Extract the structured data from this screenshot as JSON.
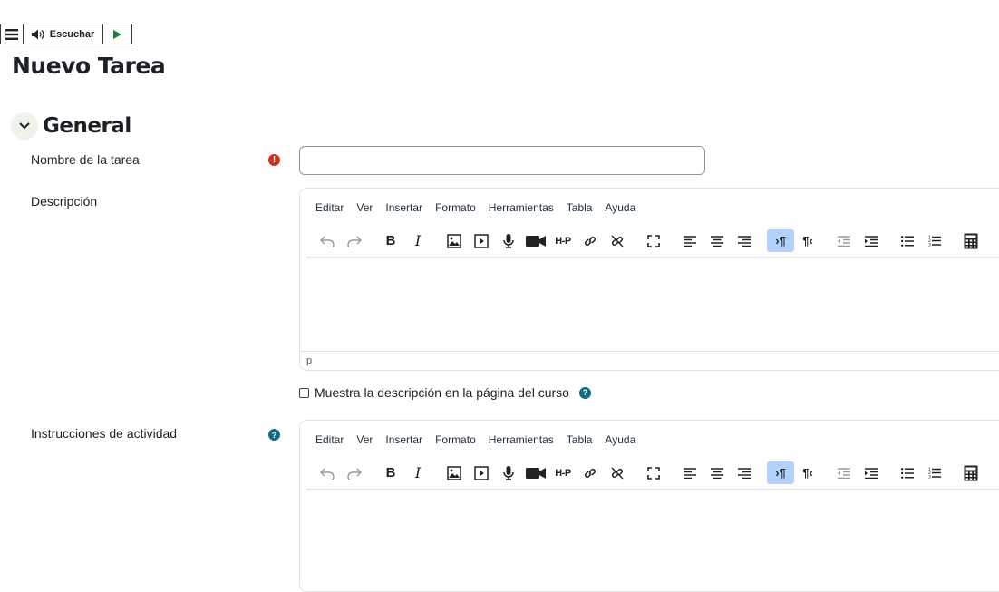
{
  "readspeaker": {
    "listen_label": "Escuchar"
  },
  "page": {
    "title": "Nuevo Tarea"
  },
  "section": {
    "title": "General"
  },
  "fields": {
    "name": {
      "label": "Nombre de la tarea",
      "value": "",
      "required_mark": "!"
    },
    "description": {
      "label": "Descripción",
      "status_path": "p"
    },
    "show_description": {
      "label": "Muestra la descripción en la página del curso",
      "checked": false
    },
    "instructions": {
      "label": "Instrucciones de actividad"
    }
  },
  "editor": {
    "menu": [
      "Editar",
      "Ver",
      "Insertar",
      "Formato",
      "Herramientas",
      "Tabla",
      "Ayuda"
    ],
    "toolbar_icons": [
      "undo-icon",
      "redo-icon",
      "bold-icon",
      "italic-icon",
      "image-icon",
      "media-icon",
      "record-audio-icon",
      "record-video-icon",
      "h5p-icon",
      "link-icon",
      "unlink-icon",
      "fullscreen-icon",
      "align-left-icon",
      "align-center-icon",
      "align-right-icon",
      "ltr-icon",
      "rtl-icon",
      "outdent-icon",
      "indent-icon",
      "bullet-list-icon",
      "numbered-list-icon",
      "equation-editor-icon"
    ],
    "h5p_label": "H-P"
  },
  "help_glyph": "?",
  "colors": {
    "required": "#ca3120",
    "help": "#0f6e84",
    "active_button": "#b3d1ff",
    "play": "#1a7f37"
  }
}
